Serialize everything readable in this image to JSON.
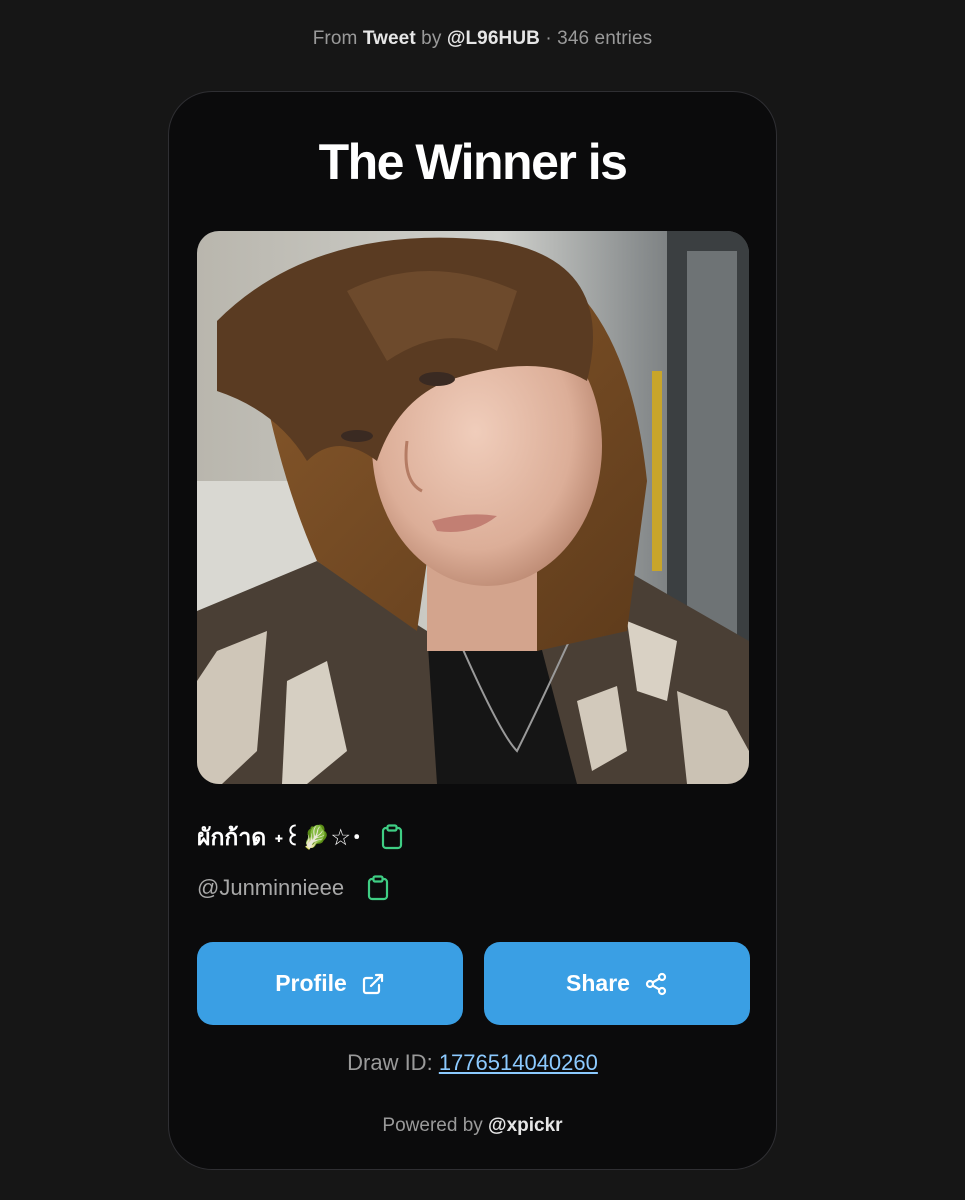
{
  "header": {
    "from_label": "From",
    "source_type": "Tweet",
    "by_label": "by",
    "author": "@L96HUB",
    "entries_text": "· 346 entries"
  },
  "card": {
    "title": "The Winner is",
    "winner": {
      "display_name": "ผักก้าด ˖꒰🥬☆･",
      "handle": "@Junminnieee"
    },
    "buttons": {
      "profile_label": "Profile",
      "share_label": "Share"
    },
    "draw": {
      "label": "Draw ID:",
      "id": "1776514040260"
    },
    "footer": {
      "powered_label": "Powered by",
      "brand": "@xpickr"
    }
  },
  "colors": {
    "accent": "#3a9fe4",
    "copy_icon": "#3fce84",
    "link": "#8ccaff",
    "card_bg": "#0b0b0c",
    "page_bg": "#161616"
  },
  "icons": {
    "copy": "clipboard-icon",
    "profile": "external-link-icon",
    "share": "share-icon"
  }
}
